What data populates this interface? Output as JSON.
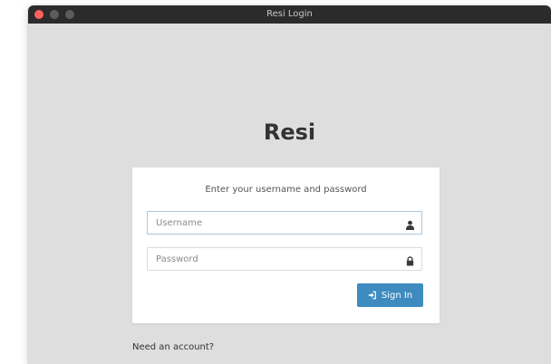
{
  "window": {
    "title": "Resi Login"
  },
  "app": {
    "brand": "Resi"
  },
  "login": {
    "prompt": "Enter your username and password",
    "username_placeholder": "Username",
    "password_placeholder": "Password",
    "signin_label": "Sign In",
    "username_icon": "user-icon",
    "password_icon": "lock-icon",
    "signin_icon": "sign-in-icon"
  },
  "footer": {
    "register_link": "Need an account?"
  },
  "colors": {
    "titlebar": "#2b2b2b",
    "background": "#dedede",
    "panel": "#ffffff",
    "accent": "#3d8bbf",
    "close_button": "#fc615d"
  }
}
